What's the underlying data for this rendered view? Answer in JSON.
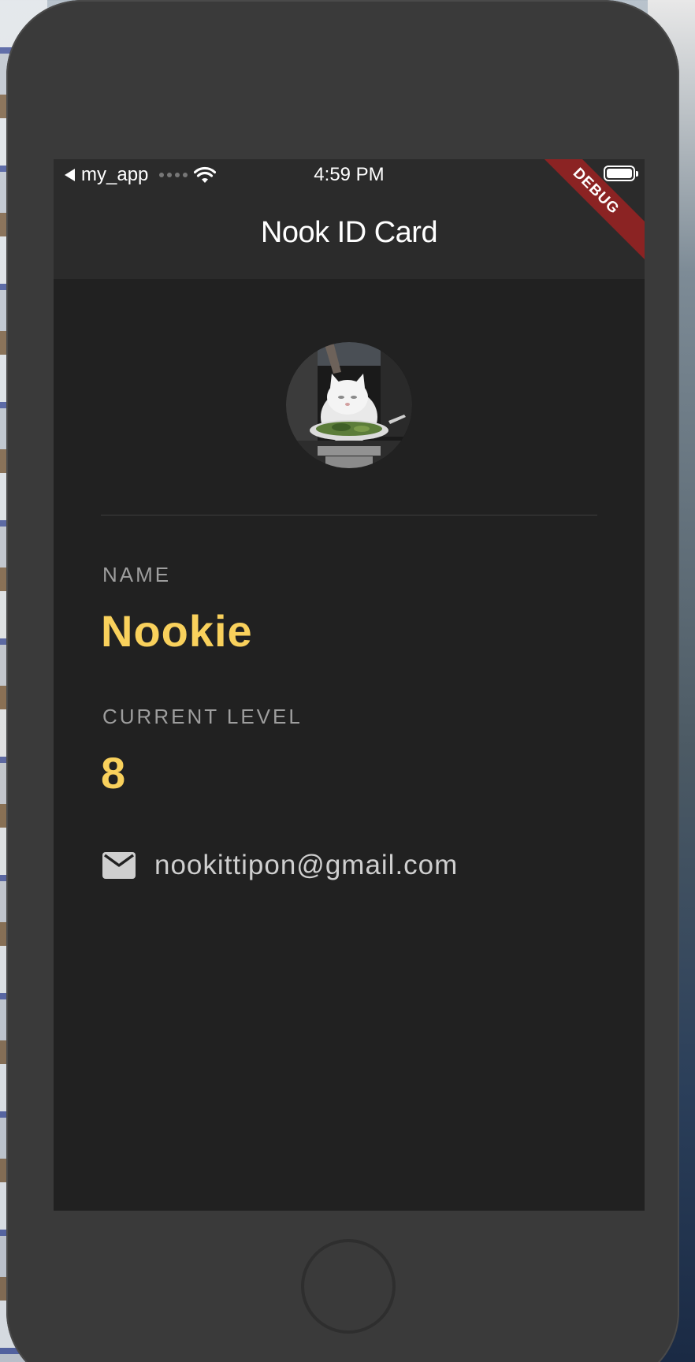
{
  "status_bar": {
    "app_name": "my_app",
    "time": "4:59 PM"
  },
  "app_bar": {
    "title": "Nook ID Card",
    "debug_banner": "DEBUG"
  },
  "profile": {
    "name_label": "NAME",
    "name": "Nookie",
    "level_label": "CURRENT LEVEL",
    "level": "8",
    "email": "nookittipon@gmail.com"
  },
  "colors": {
    "accent": "#f9d15c",
    "background": "#212121",
    "app_bar": "#2b2b2b",
    "debug_ribbon": "#8b2323"
  },
  "icons": [
    "back-arrow-icon",
    "wifi-icon",
    "battery-icon",
    "mail-icon"
  ]
}
